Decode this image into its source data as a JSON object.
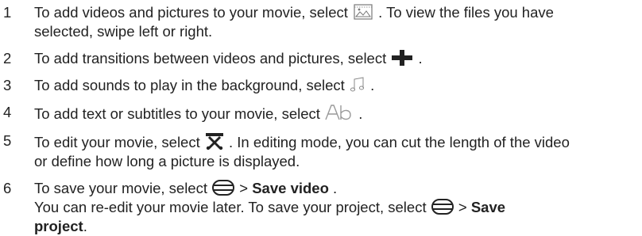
{
  "steps": [
    {
      "num": "1",
      "line1_a": "To add videos and pictures to your movie, select ",
      "line1_b": ". To view the files you have",
      "line2": "selected, swipe left or right."
    },
    {
      "num": "2",
      "line1_a": "To add transitions between videos and pictures, select ",
      "line1_b": "."
    },
    {
      "num": "3",
      "line1_a": "To add sounds to play in the background, select ",
      "line1_b": "."
    },
    {
      "num": "4",
      "line1_a": "To add text or subtitles to your movie, select ",
      "line1_b": "."
    },
    {
      "num": "5",
      "line1_a": "To edit your movie, select ",
      "line1_b": ". In editing mode, you can cut the length of the video",
      "line2": "or define how long a picture is displayed."
    },
    {
      "num": "6",
      "line1_a": "To save your movie, select ",
      "line1_sep": " > ",
      "line1_bold": "Save video",
      "line1_end": ".",
      "line2_a": "You can re-edit your movie later. To save your project, select ",
      "line2_sep": " > ",
      "line2_bold": "Save",
      "line3_bold": "project",
      "line3_end": "."
    }
  ],
  "icons": {
    "step1": "picture-gallery-icon",
    "step2": "plus-icon",
    "step3": "music-note-icon",
    "step4": "text-ab-icon",
    "step5": "scissors-edit-icon",
    "step6": "menu-icon"
  }
}
